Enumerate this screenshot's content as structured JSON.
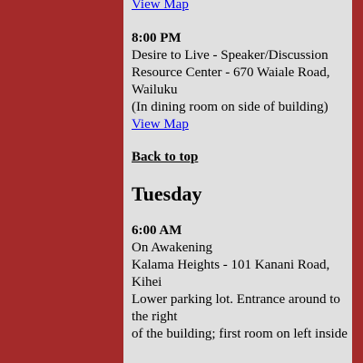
{
  "meetings_before": {
    "view_map_label": "View Map"
  },
  "meeting_800pm": {
    "time": "8:00 PM",
    "title": "Desire to Live - Speaker/Discussion",
    "address": "Resource Center - 670 Waiale Road, Wailuku",
    "note": "(In dining room on side of building)",
    "view_map_label": "View Map"
  },
  "back_to_top_label": "Back to top",
  "tuesday": {
    "heading": "Tuesday",
    "meeting_600am": {
      "time": "6:00 AM",
      "title": "On Awakening",
      "address": "Kalama Heights - 101 Kanani Road, Kihei",
      "note_line1": "Lower parking lot. Entrance around to the right",
      "note_line2": "of the building; first room on left inside"
    }
  },
  "colors": {
    "background": "#a42a2a",
    "content_panel": "#e0e0e0",
    "link": "#0000ee"
  }
}
